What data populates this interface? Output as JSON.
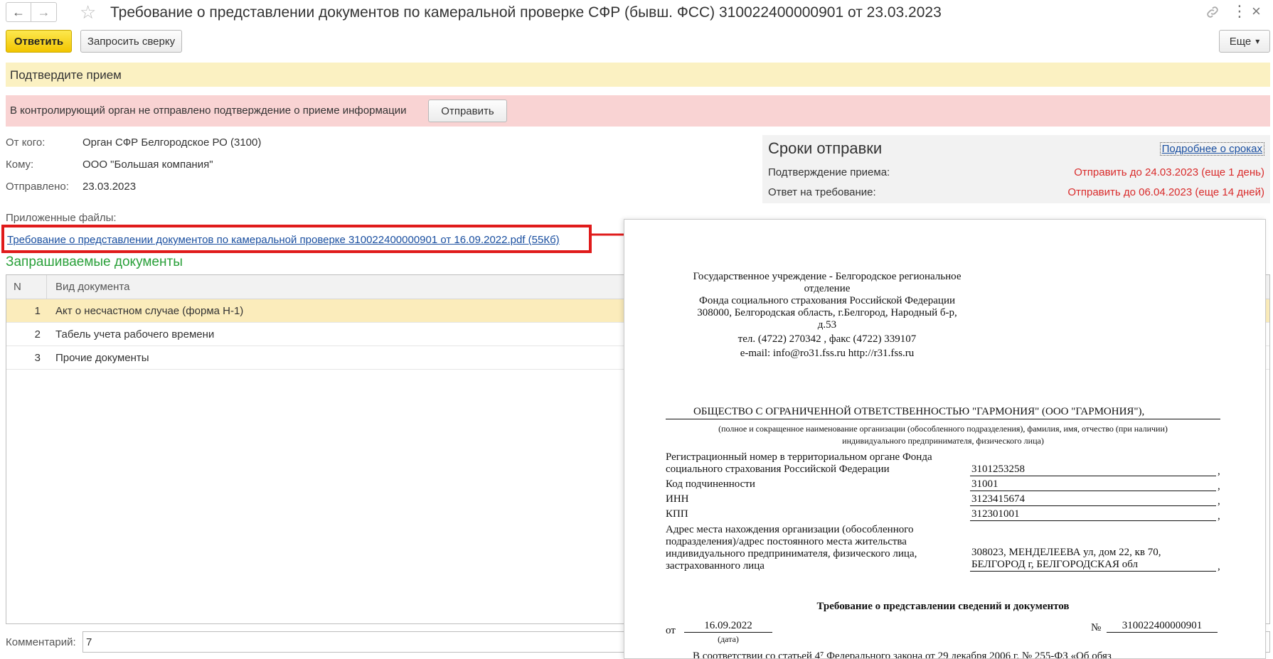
{
  "header": {
    "title": "Требование о представлении документов по камеральной проверке СФР (бывш. ФСС) 310022400000901 от 23.03.2023",
    "back_icon": "←",
    "forward_icon": "→",
    "star_icon": "☆",
    "more_icon": "⋮",
    "close_icon": "×"
  },
  "toolbar": {
    "reply_label": "Ответить",
    "reconcile_label": "Запросить сверку",
    "more_label": "Еще",
    "more_arrow": "▾"
  },
  "banner_confirm": "Подтвердите прием",
  "banner_warning": {
    "message": "В контролирующий орган не отправлено подтверждение о приеме информации",
    "send_label": "Отправить"
  },
  "info": {
    "from_label": "От кого:",
    "from_value": "Орган СФР Белгородское РО (3100)",
    "to_label": "Кому:",
    "to_value": "ООО \"Большая компания\"",
    "sent_label": "Отправлено:",
    "sent_value": "23.03.2023",
    "files_label": "Приложенные файлы:",
    "file_link": "Требование о представлении документов по камеральной проверке 310022400000901 от 16.09.2022.pdf (55Кб)"
  },
  "deadlines": {
    "title": "Сроки отправки",
    "more_link": "Подробнее о сроках",
    "rows": [
      {
        "label": "Подтверждение приема:",
        "value": "Отправить до 24.03.2023 (еще 1 день)"
      },
      {
        "label": "Ответ на требование:",
        "value": "Отправить до 06.04.2023 (еще 14 дней)"
      }
    ]
  },
  "docs": {
    "title": "Запрашиваемые документы",
    "columns": [
      "N",
      "Вид документа"
    ],
    "rows": [
      {
        "n": "1",
        "name": "Акт о несчастном случае (форма Н-1)"
      },
      {
        "n": "2",
        "name": "Табель учета рабочего времени"
      },
      {
        "n": "3",
        "name": "Прочие документы"
      }
    ]
  },
  "comment": {
    "label": "Комментарий:",
    "value": "7"
  },
  "preview": {
    "org_lines": [
      "Государственное учреждение - Белгородское региональное",
      "отделение",
      "Фонда социального страхования Российской Федерации",
      "308000, Белгородская область, г.Белгород, Народный б-р,",
      "д.53",
      "тел. (4722) 270342 ,   факс (4722) 339107",
      "e-mail: info@ro31.fss.ru    http://r31.fss.ru"
    ],
    "company": "ОБЩЕСТВО С ОГРАНИЧЕННОЙ ОТВЕТСТВЕННОСТЬЮ \"ГАРМОНИЯ\" (ООО \"ГАРМОНИЯ\"),",
    "company_note_1": "(полное и сокращенное наименование организации (обособленного подразделения), фамилия, имя, отчество (при наличии)",
    "company_note_2": "индивидуального предпринимателя, физического лица)",
    "reg_label_1": "Регистрационный номер в территориальном органе Фонда",
    "reg_label_2": "социального страхования Российской Федерации",
    "reg_value": "3101253258",
    "sub_label": "Код подчиненности",
    "sub_value": "31001",
    "inn_label": "ИНН",
    "inn_value": "3123415674",
    "kpp_label": "КПП",
    "kpp_value": "312301001",
    "addr_label_1": "Адрес места нахождения организации (обособленного",
    "addr_label_2": "подразделения)/адрес постоянного места жительства",
    "addr_label_3": "индивидуального предпринимателя, физического лица,",
    "addr_label_4": "застрахованного лица",
    "addr_value_1": "308023, МЕНДЕЛЕЕВА ул, дом 22, кв 70,",
    "addr_value_2": "БЕЛГОРОД г, БЕЛГОРОДСКАЯ обл",
    "comma": ",",
    "doc_title": "Требование о представлении сведений и документов",
    "from_prefix": "от",
    "date_value": "16.09.2022",
    "date_caption": "(дата)",
    "num_prefix": "№",
    "num_value": "310022400000901",
    "bottom_line": "В соответствии со статьей 4⁷ Федерального закона от 29 декабря 2006 г. № 255-ФЗ «Об обяз"
  }
}
